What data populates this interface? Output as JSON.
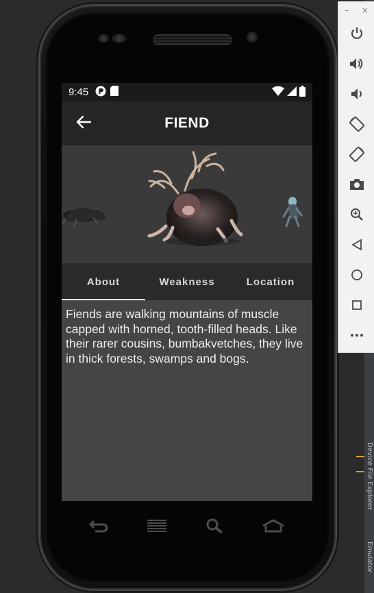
{
  "status_bar": {
    "time": "9:45"
  },
  "app_bar": {
    "title": "FIEND"
  },
  "tabs": [
    {
      "label": "About",
      "active": true
    },
    {
      "label": "Weakness",
      "active": false
    },
    {
      "label": "Location",
      "active": false
    }
  ],
  "about": {
    "text": "Fiends are walking mountains of muscle capped with horned, tooth-filled heads. Like their rarer cousins, bumbakvetches, they live in thick forests, swamps and bogs."
  },
  "emulator_toolbar": {
    "minimize": "–",
    "close": "×",
    "buttons": [
      "power-icon",
      "volume-up-icon",
      "volume-down-icon",
      "rotate-left-icon",
      "rotate-right-icon",
      "camera-icon",
      "zoom-icon",
      "back-icon",
      "home-icon",
      "overview-icon",
      "more-icon"
    ]
  },
  "ide": {
    "device_file_explorer": "Device File Explorer",
    "emulator": "Emulator"
  },
  "colors": {
    "screen_bg": "#454545",
    "app_bar_bg": "#252525",
    "tab_bar_bg": "#2a2a2a",
    "status_bar_bg": "#1b1b1b",
    "ide_bg": "#2b2b2b",
    "accent_marks": "#d39b3a"
  }
}
